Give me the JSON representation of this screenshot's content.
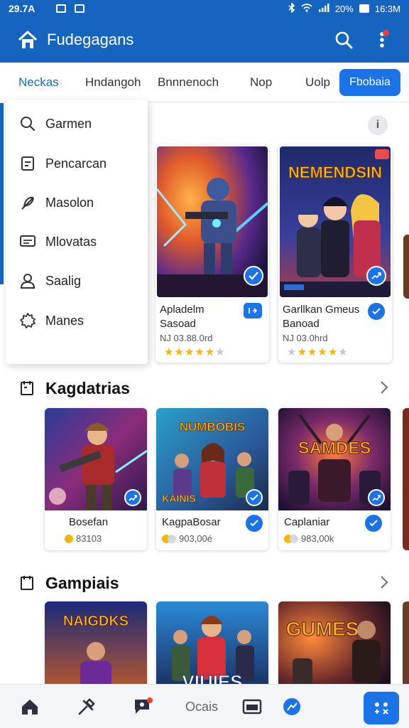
{
  "status_bar": {
    "time": "29.7A",
    "right_text": "20%",
    "clock": "16:3M"
  },
  "app_bar": {
    "title": "Fudegagans",
    "home_icon": "home-icon",
    "search_icon": "search-icon",
    "more_icon": "more-vert-icon"
  },
  "tabs": [
    {
      "label": "Neckas"
    },
    {
      "label": "Hndangoh"
    },
    {
      "label": "Bnnnenoch"
    },
    {
      "label": "Nop"
    },
    {
      "label": "Uolp"
    },
    {
      "label": "Fbobaia"
    }
  ],
  "menu": {
    "items": [
      {
        "label": "Garmen",
        "icon": "search-icon"
      },
      {
        "label": "Pencarcan",
        "icon": "list-icon"
      },
      {
        "label": "Masolon",
        "icon": "feather-icon"
      },
      {
        "label": "Mlovatas",
        "icon": "message-icon"
      },
      {
        "label": "Saalig",
        "icon": "user-icon"
      },
      {
        "label": "Manes",
        "icon": "gear-icon"
      }
    ]
  },
  "featured": [
    {
      "name": "Apladelm Sasoad",
      "meta": "NJ 03.88.0rd",
      "rating": 5,
      "art_title": ""
    },
    {
      "name": "Garllkan Gmeus Banoad",
      "meta": "NJ 03.0hrd",
      "rating": 4,
      "art_title": "NEMENDSIN"
    }
  ],
  "sections": [
    {
      "title": "Kagdatrias",
      "cards": [
        {
          "name": "Bosefan",
          "price": "83103",
          "art_title": ""
        },
        {
          "name": "KagpaBosar",
          "price": "903,00é",
          "art_title": "NUMBOBIS"
        },
        {
          "name": "Caplaniar",
          "price": "983,00k",
          "art_title": "SAMDES"
        }
      ]
    },
    {
      "title": "Gampiais",
      "cards": [
        {
          "art_title": "NAIGDKS"
        },
        {
          "art_title": "VIUIES"
        },
        {
          "art_title": "GUMES"
        }
      ]
    }
  ],
  "bottom_nav": {
    "label": "Ocais"
  },
  "colors": {
    "primary": "#1565c0",
    "accent": "#1a73e8",
    "star": "#f7b500"
  }
}
